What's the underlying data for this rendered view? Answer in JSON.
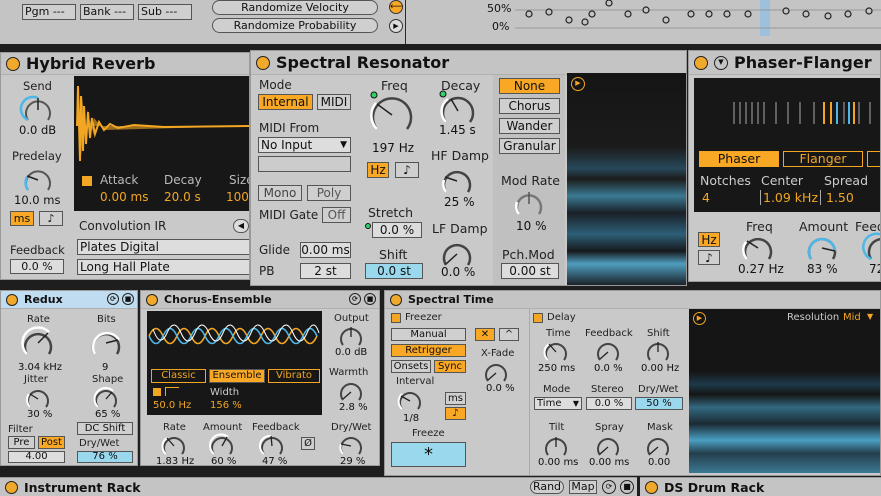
{
  "top": {
    "pgm": "Pgm ---",
    "bank": "Bank ---",
    "sub": "Sub ---",
    "rand_velocity": "Randomize Velocity",
    "rand_probability": "Randomize Probability",
    "pct50": "50%",
    "pct0": "0%"
  },
  "hybrid": {
    "title": "Hybrid Reverb",
    "send_label": "Send",
    "send_value": "0.0 dB",
    "predelay_label": "Predelay",
    "predelay_value": "10.0 ms",
    "ms": "ms",
    "note": "♪",
    "feedback_label": "Feedback",
    "feedback_value": "0.0 %",
    "attack_label": "Attack",
    "attack_value": "0.00 ms",
    "decay_label": "Decay",
    "decay_value": "20.0 s",
    "size_label": "Size",
    "size_value": "100",
    "conv_label": "Convolution IR",
    "ir_category": "Plates Digital",
    "ir_name": "Long Hall Plate"
  },
  "spectral_res": {
    "title": "Spectral Resonator",
    "mode_label": "Mode",
    "internal": "Internal",
    "midi": "MIDI",
    "midi_from_label": "MIDI From",
    "no_input": "No Input",
    "mono": "Mono",
    "poly": "Poly",
    "midi_gate_label": "MIDI Gate",
    "off": "Off",
    "glide_label": "Glide",
    "glide_value": "0.00 ms",
    "pb_label": "PB",
    "pb_value": "2 st",
    "freq_label": "Freq",
    "freq_value": "197 Hz",
    "hz": "Hz",
    "note": "♪",
    "stretch_label": "Stretch",
    "stretch_value": "0.0 %",
    "shift_label": "Shift",
    "shift_value": "0.0 st",
    "decay_label": "Decay",
    "decay_value": "1.45 s",
    "hfdamp_label": "HF Damp",
    "hfdamp_value": "25 %",
    "lfdamp_label": "LF Damp",
    "lfdamp_value": "0.0 %",
    "modes": [
      "None",
      "Chorus",
      "Wander",
      "Granular"
    ],
    "modrate_label": "Mod Rate",
    "modrate_value": "10 %",
    "pchmod_label": "Pch.Mod",
    "pchmod_value": "0.00 st"
  },
  "phaser": {
    "title": "Phaser-Flanger",
    "phaser": "Phaser",
    "flanger": "Flanger",
    "notches_label": "Notches",
    "notches_value": "4",
    "center_label": "Center",
    "center_value": "1.09 kHz",
    "spread_label": "Spread",
    "spread_value": "1.50",
    "hz": "Hz",
    "note": "♪",
    "freq_label": "Freq",
    "freq_value": "0.27 Hz",
    "amount_label": "Amount",
    "amount_value": "83 %",
    "feedback_label": "Feed",
    "feedback_value": "72"
  },
  "redux": {
    "title": "Redux",
    "rate_label": "Rate",
    "rate_value": "3.04 kHz",
    "bits_label": "Bits",
    "bits_value": "9",
    "jitter_label": "Jitter",
    "jitter_value": "30 %",
    "shape_label": "Shape",
    "shape_value": "65 %",
    "filter_label": "Filter",
    "pre": "Pre",
    "post": "Post",
    "dcshift": "DC Shift",
    "drywet_label": "Dry/Wet",
    "filter_value": "4.00",
    "drywet_value": "76 %"
  },
  "chorus": {
    "title": "Chorus-Ensemble",
    "output_label": "Output",
    "output_value": "0.0 dB",
    "classic": "Classic",
    "ensemble": "Ensemble",
    "vibrato": "Vibrato",
    "lfo_value": "50.0 Hz",
    "width_label": "Width",
    "width_value": "156 %",
    "warmth_label": "Warmth",
    "warmth_value": "2.8 %",
    "rate_label": "Rate",
    "rate_value": "1.83 Hz",
    "amount_label": "Amount",
    "amount_value": "60 %",
    "feedback_label": "Feedback",
    "feedback_value": "47 %",
    "phi": "Ø",
    "drywet_label": "Dry/Wet",
    "drywet_value": "29 %"
  },
  "spectral_time": {
    "title": "Spectral Time",
    "freezer_label": "Freezer",
    "manual": "Manual",
    "retrigger": "Retrigger",
    "onsets": "Onsets",
    "sync": "Sync",
    "xfade_label": "X-Fade",
    "xfade_value": "0.0 %",
    "interval_label": "Interval",
    "interval_value": "1/8",
    "ms": "ms",
    "note": "♪",
    "freeze_label": "Freeze",
    "freeze_symbol": "*",
    "delay_label": "Delay",
    "time_label": "Time",
    "time_value": "250 ms",
    "feedback_label": "Feedback",
    "feedback_value": "0.0 %",
    "shift_label": "Shift",
    "shift_value": "0.00 Hz",
    "mode_label": "Mode",
    "mode_value": "Time",
    "stereo_label": "Stereo",
    "stereo_value": "0.0 %",
    "drywet_label": "Dry/Wet",
    "drywet_value": "50 %",
    "tilt_label": "Tilt",
    "tilt_value": "0.00 ms",
    "spray_label": "Spray",
    "spray_value": "0.00 ms",
    "mask_label": "Mask",
    "mask_value": "0.00",
    "resolution_label": "Resolution",
    "resolution_value": "Mid"
  },
  "bottom": {
    "instrument_rack": "Instrument Rack",
    "rand": "Rand",
    "map": "Map",
    "ds_drum": "DS Drum Rack"
  },
  "colors": {
    "accent": "#f9a825",
    "panel": "#c9c9c9",
    "display": "#171717",
    "blue": "#4db8e8"
  }
}
